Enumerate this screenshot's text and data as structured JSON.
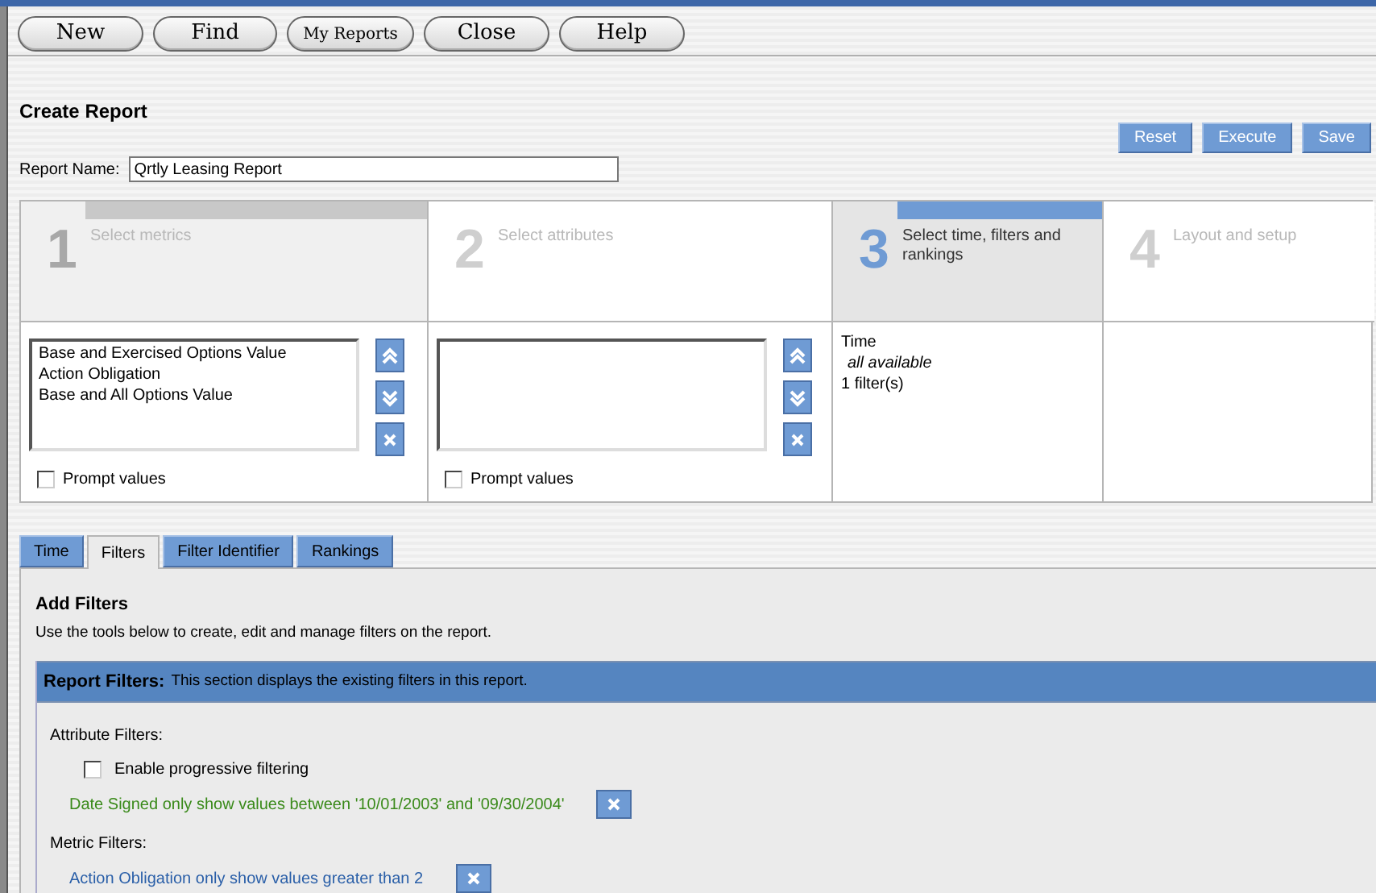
{
  "toolbar": {
    "buttons": [
      "New",
      "Find",
      "My Reports",
      "Close",
      "Help"
    ]
  },
  "title": "Create Report",
  "actions": [
    "Reset",
    "Execute",
    "Save"
  ],
  "report_name": {
    "label": "Report Name:",
    "value": "Qrtly Leasing Report"
  },
  "steps": [
    {
      "number": "1",
      "label": "Select metrics",
      "completed": true,
      "selected": false,
      "kind": "list",
      "items": [
        "Base and Exercised Options Value",
        "Action Obligation",
        "Base and All Options Value"
      ],
      "prompt": {
        "label": "Prompt values",
        "checked": false
      }
    },
    {
      "number": "2",
      "label": "Select attributes",
      "completed": false,
      "selected": false,
      "kind": "list",
      "prompt": {
        "label": "Prompt values",
        "checked": false
      }
    },
    {
      "number": "3",
      "label": "Select time, filters and rankings",
      "completed": false,
      "selected": true,
      "kind": "summary",
      "lines": [
        {
          "text": "Time",
          "italic": false
        },
        {
          "text": "all available",
          "italic": true
        },
        {
          "text": "1 filter(s)",
          "italic": false
        }
      ]
    },
    {
      "number": "4",
      "label": "Layout and setup",
      "completed": false,
      "selected": false,
      "kind": "empty"
    }
  ],
  "tabs": [
    {
      "label": "Time",
      "selected": false
    },
    {
      "label": "Filters",
      "selected": true
    },
    {
      "label": "Filter Identifier",
      "selected": false
    },
    {
      "label": "Rankings",
      "selected": false
    }
  ],
  "filters": {
    "title": "Add Filters",
    "description": "Use the tools below to create, edit and manage filters on the report.",
    "section": {
      "title": "Report Filters:",
      "note": "This section displays the existing filters in this report."
    },
    "attribute_filters": {
      "label": "Attribute Filters:",
      "progressive": {
        "label": "Enable progressive filtering",
        "checked": false
      },
      "items": [
        "Date Signed only show values between '10/01/2003' and '09/30/2004'"
      ]
    },
    "metric_filters": {
      "label": "Metric Filters:",
      "items": [
        "Action Obligation only show values greater than 2"
      ]
    }
  }
}
